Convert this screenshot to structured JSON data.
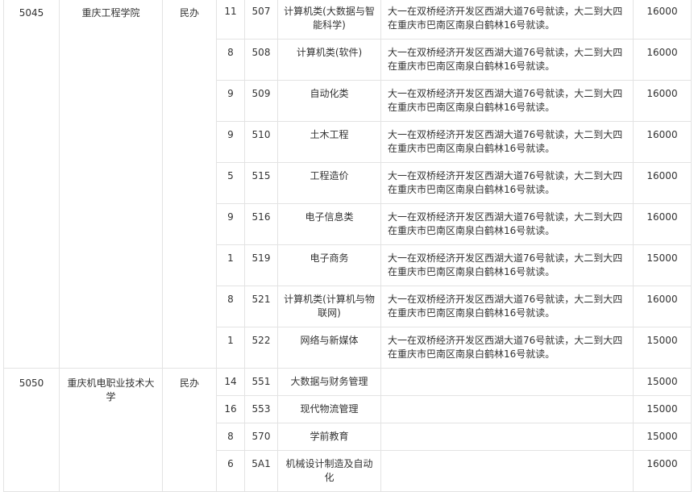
{
  "schools": [
    {
      "code": "5045",
      "name": "重庆工程学院",
      "type": "民办",
      "majors": [
        {
          "plan": "11",
          "code": "507",
          "name": "计算机类(大数据与智能科学)",
          "note": "大一在双桥经济开发区西湖大道76号就读，大二到大四在重庆市巴南区南泉白鹤林16号就读。",
          "fee": "16000"
        },
        {
          "plan": "8",
          "code": "508",
          "name": "计算机类(软件)",
          "note": "大一在双桥经济开发区西湖大道76号就读，大二到大四在重庆市巴南区南泉白鹤林16号就读。",
          "fee": "16000"
        },
        {
          "plan": "9",
          "code": "509",
          "name": "自动化类",
          "note": "大一在双桥经济开发区西湖大道76号就读，大二到大四在重庆市巴南区南泉白鹤林16号就读。",
          "fee": "16000"
        },
        {
          "plan": "9",
          "code": "510",
          "name": "土木工程",
          "note": "大一在双桥经济开发区西湖大道76号就读，大二到大四在重庆市巴南区南泉白鹤林16号就读。",
          "fee": "16000"
        },
        {
          "plan": "5",
          "code": "515",
          "name": "工程造价",
          "note": "大一在双桥经济开发区西湖大道76号就读，大二到大四在重庆市巴南区南泉白鹤林16号就读。",
          "fee": "16000"
        },
        {
          "plan": "9",
          "code": "516",
          "name": "电子信息类",
          "note": "大一在双桥经济开发区西湖大道76号就读，大二到大四在重庆市巴南区南泉白鹤林16号就读。",
          "fee": "16000"
        },
        {
          "plan": "1",
          "code": "519",
          "name": "电子商务",
          "note": "大一在双桥经济开发区西湖大道76号就读，大二到大四在重庆市巴南区南泉白鹤林16号就读。",
          "fee": "15000"
        },
        {
          "plan": "8",
          "code": "521",
          "name": "计算机类(计算机与物联网)",
          "note": "大一在双桥经济开发区西湖大道76号就读，大二到大四在重庆市巴南区南泉白鹤林16号就读。",
          "fee": "16000"
        },
        {
          "plan": "1",
          "code": "522",
          "name": "网络与新媒体",
          "note": "大一在双桥经济开发区西湖大道76号就读，大二到大四在重庆市巴南区南泉白鹤林16号就读。",
          "fee": "15000"
        }
      ]
    },
    {
      "code": "5050",
      "name": "重庆机电职业技术大学",
      "type": "民办",
      "majors": [
        {
          "plan": "14",
          "code": "551",
          "name": "大数据与财务管理",
          "note": "",
          "fee": "15000"
        },
        {
          "plan": "16",
          "code": "553",
          "name": "现代物流管理",
          "note": "",
          "fee": "15000"
        },
        {
          "plan": "8",
          "code": "570",
          "name": "学前教育",
          "note": "",
          "fee": "15000"
        },
        {
          "plan": "6",
          "code": "5A1",
          "name": "机械设计制造及自动化",
          "note": "",
          "fee": "16000"
        }
      ]
    }
  ]
}
